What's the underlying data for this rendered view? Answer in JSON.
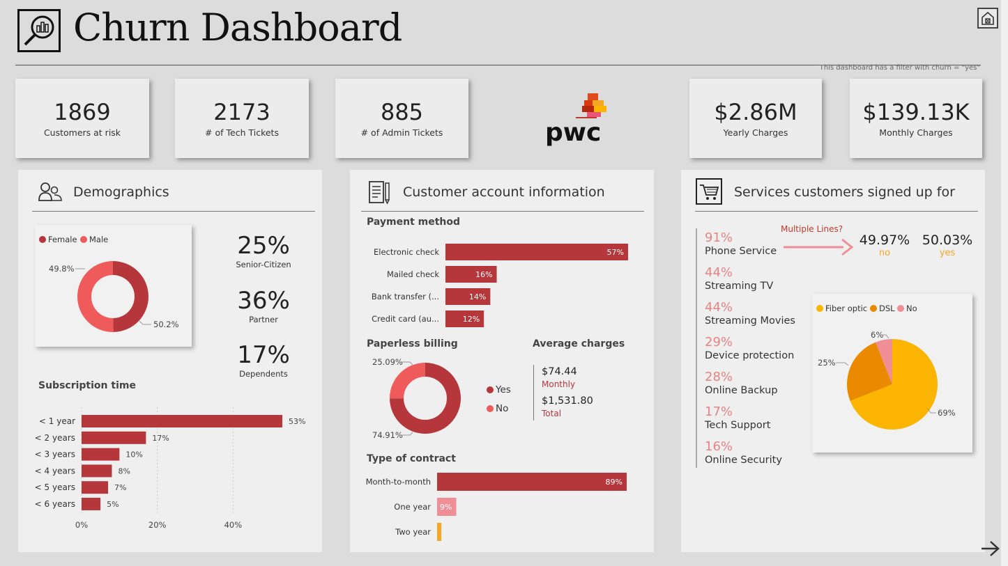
{
  "header": {
    "title": "Churn Dashboard",
    "filter_note": "This dashboard has a filter with churn = \"yes\""
  },
  "kpis": [
    {
      "value": "1869",
      "label": "Customers at risk"
    },
    {
      "value": "2173",
      "label": "# of Tech Tickets"
    },
    {
      "value": "885",
      "label": "# of Admin Tickets"
    },
    {
      "value": "$2.86M",
      "label": "Yearly Charges"
    },
    {
      "value": "$139.13K",
      "label": "Monthly Charges"
    }
  ],
  "brand": {
    "logo_text": "pwc"
  },
  "demographics": {
    "title": "Demographics",
    "legend": [
      "Female",
      "Male"
    ],
    "gender": {
      "female_label": "49.8%",
      "male_label": "50.2%"
    },
    "stats": [
      {
        "value": "25%",
        "label": "Senior-Citizen"
      },
      {
        "value": "36%",
        "label": "Partner"
      },
      {
        "value": "17%",
        "label": "Dependents"
      }
    ],
    "subscription_title": "Subscription time"
  },
  "account": {
    "title": "Customer account information",
    "payment_title": "Payment method",
    "paperless_title": "Paperless billing",
    "paperless_legend": [
      "Yes",
      "No"
    ],
    "paperless_labels": {
      "no": "25.09%",
      "yes": "74.91%"
    },
    "avg_title": "Average charges",
    "avg_monthly_value": "$74.44",
    "avg_monthly_label": "Monthly",
    "avg_total_value": "$1,531.80",
    "avg_total_label": "Total",
    "contract_title": "Type of contract"
  },
  "services": {
    "title": "Services customers signed up for",
    "items": [
      {
        "pct": "91%",
        "name": "Phone Service"
      },
      {
        "pct": "44%",
        "name": "Streaming TV"
      },
      {
        "pct": "44%",
        "name": "Streaming Movies"
      },
      {
        "pct": "29%",
        "name": "Device protection"
      },
      {
        "pct": "28%",
        "name": "Online Backup"
      },
      {
        "pct": "17%",
        "name": "Tech Support"
      },
      {
        "pct": "16%",
        "name": "Online Security"
      }
    ],
    "multiple_lines": {
      "label": "Multiple Lines?",
      "no_value": "49.97%",
      "no_label": "no",
      "yes_value": "50.03%",
      "yes_label": "yes"
    },
    "internet_legend": [
      "Fiber optic",
      "DSL",
      "No"
    ]
  },
  "colors": {
    "red": "#b5363b",
    "light_red": "#ef5b5b",
    "pink": "#f08e95",
    "orange": "#f5a623",
    "amber": "#fbb400",
    "dsl": "#e98a00"
  },
  "chart_data": [
    {
      "type": "pie",
      "title": "",
      "categories": [
        "Female",
        "Male"
      ],
      "values": [
        49.8,
        50.2
      ]
    },
    {
      "type": "bar",
      "title": "Subscription time",
      "categories": [
        "< 1 year",
        "< 2 years",
        "< 3 years",
        "< 4 years",
        "< 5 years",
        "< 6 years"
      ],
      "values": [
        53,
        17,
        10,
        8,
        7,
        5
      ],
      "value_labels": [
        "53%",
        "17%",
        "10%",
        "8%",
        "7%",
        "5%"
      ],
      "x_ticks": [
        "0%",
        "20%",
        "40%"
      ],
      "xlim": [
        0,
        53
      ]
    },
    {
      "type": "bar",
      "title": "Payment method",
      "categories": [
        "Electronic check",
        "Mailed check",
        "Bank transfer (...",
        "Credit card (au..."
      ],
      "values": [
        57,
        16,
        14,
        12
      ],
      "value_labels": [
        "57%",
        "16%",
        "14%",
        "12%"
      ]
    },
    {
      "type": "pie",
      "title": "Paperless billing",
      "categories": [
        "Yes",
        "No"
      ],
      "values": [
        74.91,
        25.09
      ]
    },
    {
      "type": "bar",
      "title": "Type of contract",
      "categories": [
        "Month-to-month",
        "One year",
        "Two year"
      ],
      "values": [
        89,
        9,
        2
      ],
      "value_labels": [
        "89%",
        "9%",
        ""
      ]
    },
    {
      "type": "pie",
      "title": "",
      "categories": [
        "Fiber optic",
        "DSL",
        "No"
      ],
      "values": [
        69,
        25,
        6
      ],
      "value_labels": [
        "69%",
        "25%",
        "6%"
      ]
    }
  ]
}
